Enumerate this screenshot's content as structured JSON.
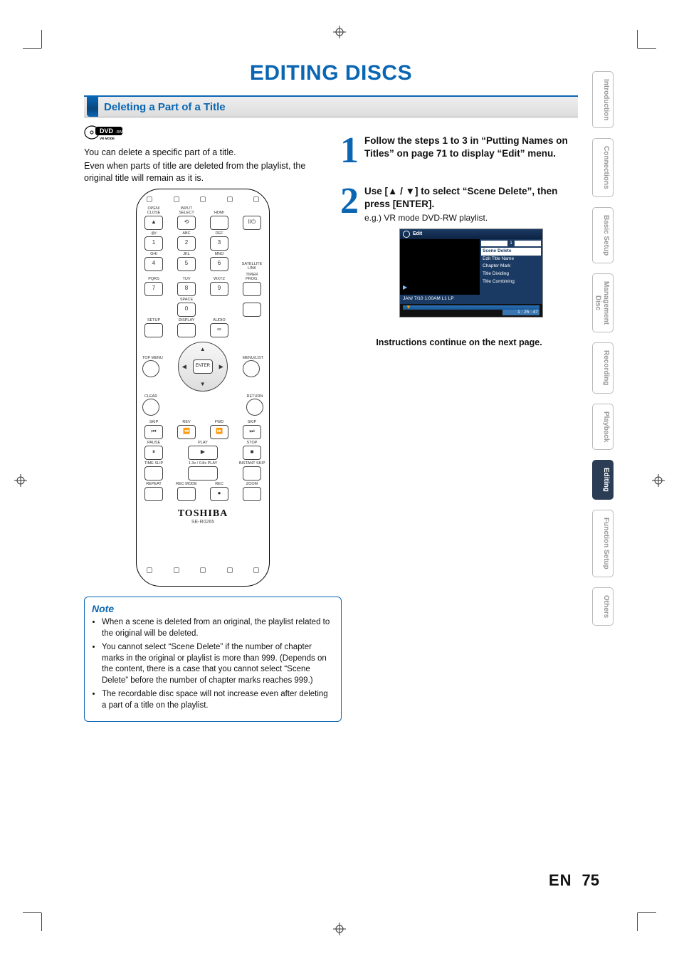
{
  "header": {
    "title": "EDITING DISCS"
  },
  "section": {
    "title": "Deleting a Part of a Title"
  },
  "badge": {
    "text": "DVD",
    "sub": "-RW",
    "mode": "VR MODE"
  },
  "intro": {
    "line1": "You can delete a specific part of a title.",
    "line2": "Even when parts of title are deleted from the playlist, the original title will remain as it is."
  },
  "remote": {
    "top_labels": {
      "open_close": "OPEN/\nCLOSE",
      "input_select": "INPUT\nSELECT",
      "hdmi": "HDMI"
    },
    "row_labels": {
      "at": ".@/:",
      "abc": "ABC",
      "def": "DEF",
      "ghi": "GHI",
      "jkl": "JKL",
      "mno": "MNO",
      "pqrs": "PQRS",
      "tuv": "TUV",
      "wxyz": "WXYZ",
      "space": "SPACE",
      "satellite": "SATELLITE\nLINK",
      "timer": "TIMER\nPROG.",
      "setup": "SETUP",
      "display": "DISPLAY",
      "audio": "AUDIO"
    },
    "nums": {
      "n1": "1",
      "n2": "2",
      "n3": "3",
      "n4": "4",
      "n5": "5",
      "n6": "6",
      "n7": "7",
      "n8": "8",
      "n9": "9",
      "n0": "0"
    },
    "power": "I/⏻",
    "nav": {
      "top_menu": "TOP MENU",
      "menu_list": "MENU/LIST",
      "enter": "ENTER",
      "clear": "CLEAR",
      "return": "RETURN"
    },
    "transport": {
      "skip_l": "SKIP",
      "rev": "REV",
      "fwd": "FWD",
      "skip_r": "SKIP",
      "pause": "PAUSE",
      "play": "PLAY",
      "stop": "STOP",
      "timeslip": "TIME SLIP",
      "speed": "1.3x / 0.8x PLAY",
      "instant": "INSTANT SKIP",
      "repeat": "REPEAT",
      "recmode": "REC MODE",
      "rec": "REC",
      "zoom": "ZOOM"
    },
    "brand": "TOSHIBA",
    "model": "SE-R0265"
  },
  "note": {
    "heading": "Note",
    "items": [
      "When a scene is deleted from an original, the playlist related to the original will be deleted.",
      "You cannot select “Scene Delete” if the number of chapter marks in the original or playlist is more than 999. (Depends on the content, there is a case that you cannot select “Scene Delete” before the number of chapter marks reaches 999.)",
      "The recordable disc space will not increase even after deleting a part of a title on the playlist."
    ]
  },
  "steps": {
    "s1": {
      "num": "1",
      "text": "Follow the steps 1 to 3 in “Putting Names on Titles” on page 71 to display “Edit” menu."
    },
    "s2": {
      "num": "2",
      "line_a_prefix": "Use [",
      "line_a_mid": " / ",
      "line_a_suffix": "] to select “Scene Delete”, then press [ENTER].",
      "eg": "e.g.) VR mode DVD-RW playlist."
    }
  },
  "osd": {
    "title": "Edit",
    "selected_index": "1",
    "menu": {
      "scene_delete": "Scene Delete",
      "edit_title_name": "Edit Title Name",
      "chapter_mark": "Chapter Mark",
      "title_dividing": "Title Dividing",
      "title_combining": "Title Combining"
    },
    "status_left": "JAN/ 7/10 1:00AM L1    LP",
    "elapsed": "1 : 25 : 47"
  },
  "continue_text": "Instructions continue on the next page.",
  "tabs": {
    "introduction": "Introduction",
    "connections": "Connections",
    "basic_setup": "Basic Setup",
    "disc_mgmt_a": "Disc",
    "disc_mgmt_b": "Management",
    "recording": "Recording",
    "playback": "Playback",
    "editing": "Editing",
    "function_setup": "Function Setup",
    "others": "Others"
  },
  "footer": {
    "en": "EN",
    "page": "75"
  }
}
